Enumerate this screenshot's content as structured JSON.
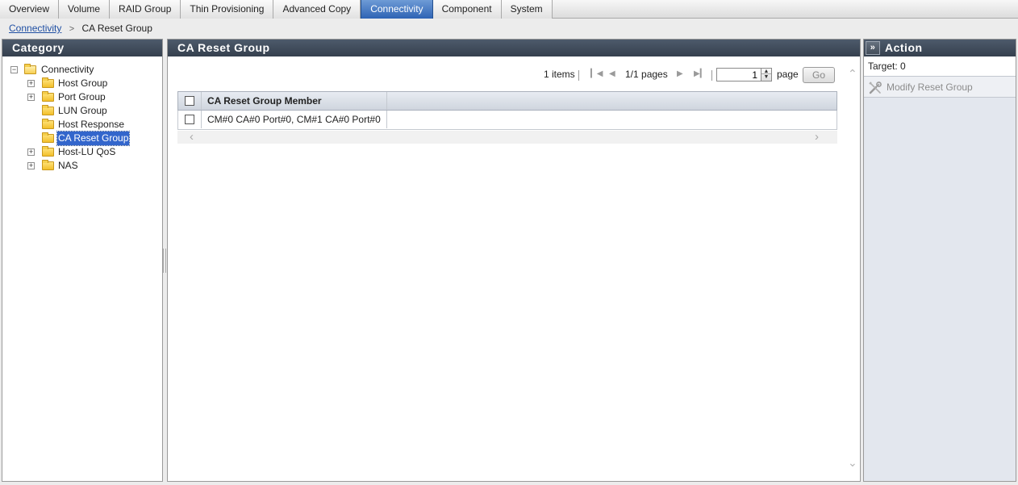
{
  "tabs": [
    {
      "label": "Overview",
      "active": false
    },
    {
      "label": "Volume",
      "active": false
    },
    {
      "label": "RAID Group",
      "active": false
    },
    {
      "label": "Thin Provisioning",
      "active": false
    },
    {
      "label": "Advanced Copy",
      "active": false
    },
    {
      "label": "Connectivity",
      "active": true
    },
    {
      "label": "Component",
      "active": false
    },
    {
      "label": "System",
      "active": false
    }
  ],
  "breadcrumb": {
    "link": "Connectivity",
    "separator": ">",
    "current": "CA Reset Group"
  },
  "category": {
    "title": "Category",
    "tree": [
      {
        "label": "Connectivity",
        "expander": "−",
        "level": 0,
        "selected": false
      },
      {
        "label": "Host Group",
        "expander": "+",
        "level": 1,
        "selected": false
      },
      {
        "label": "Port Group",
        "expander": "+",
        "level": 1,
        "selected": false
      },
      {
        "label": "LUN Group",
        "expander": "",
        "level": 1,
        "selected": false
      },
      {
        "label": "Host Response",
        "expander": "",
        "level": 1,
        "selected": false
      },
      {
        "label": "CA Reset Group",
        "expander": "",
        "level": 1,
        "selected": true
      },
      {
        "label": "Host-LU QoS",
        "expander": "+",
        "level": 1,
        "selected": false
      },
      {
        "label": "NAS",
        "expander": "+",
        "level": 1,
        "selected": false
      }
    ]
  },
  "main": {
    "title": "CA Reset Group",
    "pager": {
      "items": "1 items",
      "pages": "1/1 pages",
      "page_value": "1",
      "page_word": "page",
      "go_label": "Go",
      "first_icon": "first-page-icon",
      "prev_icon": "prev-page-icon",
      "next_icon": "next-page-icon",
      "last_icon": "last-page-icon"
    },
    "table": {
      "columns": [
        "CA Reset Group Member"
      ],
      "rows": [
        [
          "CM#0 CA#0 Port#0, CM#1 CA#0 Port#0"
        ]
      ]
    }
  },
  "action": {
    "title": "Action",
    "collapse_symbol": "»",
    "target": "Target:  0",
    "items": [
      {
        "label": "Modify Reset Group",
        "icon": "wrench-icon",
        "enabled": false
      }
    ]
  }
}
